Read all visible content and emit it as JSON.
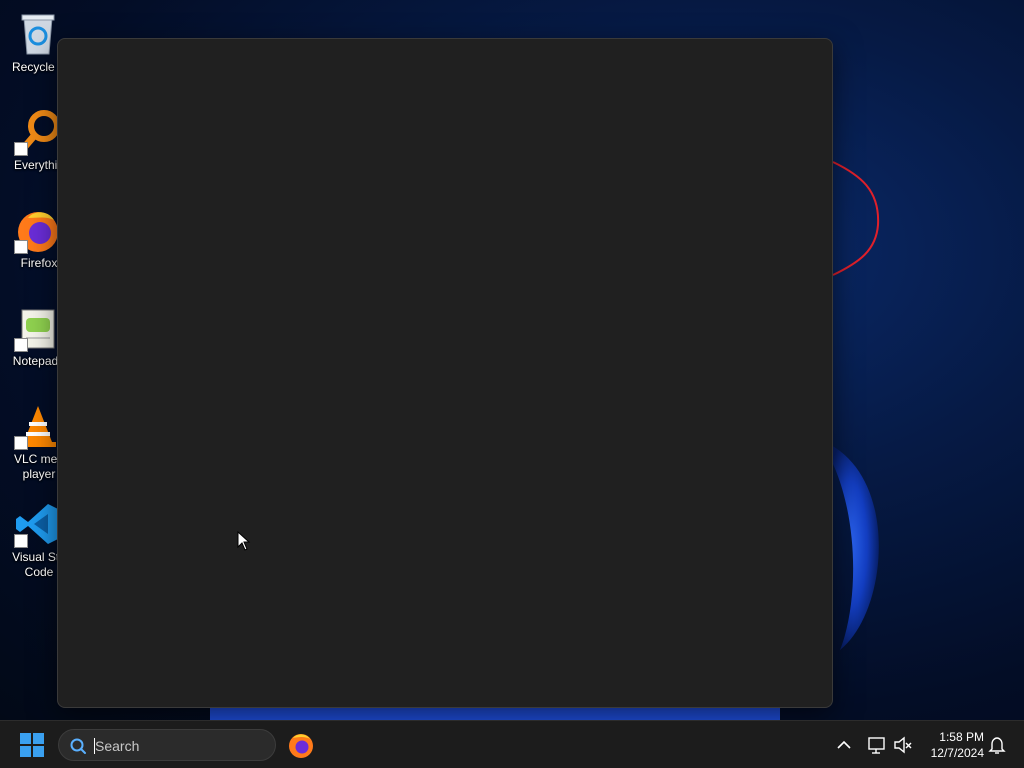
{
  "desktop": {
    "icons": [
      {
        "label": "Recycle B",
        "name": "recycle-bin-icon"
      },
      {
        "label": "Everythin",
        "name": "everything-search-icon"
      },
      {
        "label": "Firefox",
        "name": "firefox-icon"
      },
      {
        "label": "Notepad+",
        "name": "notepad-plus-plus-icon"
      },
      {
        "label": "VLC med player",
        "name": "vlc-media-player-icon"
      },
      {
        "label": "Visual Stu Code",
        "name": "visual-studio-code-icon"
      }
    ]
  },
  "taskbar": {
    "search_placeholder": "Search",
    "clock_time": "1:58 PM",
    "clock_date": "12/7/2024"
  },
  "colors": {
    "taskbar_bg": "#1c1c1c",
    "window_bg": "#202020",
    "accent": "#0078d4"
  }
}
